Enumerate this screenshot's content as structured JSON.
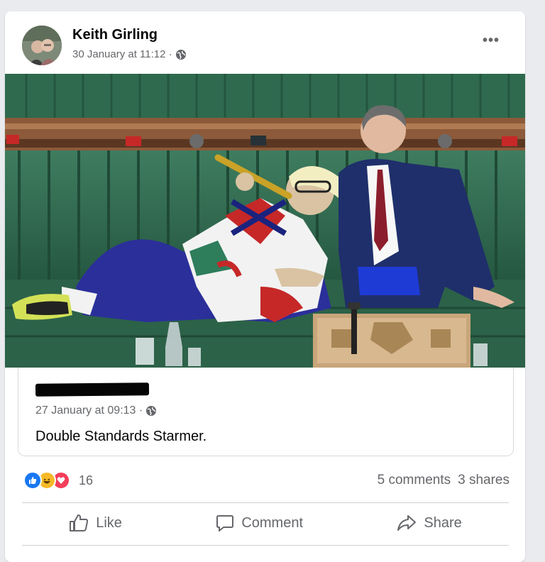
{
  "post": {
    "author": "Keith Girling",
    "timestamp": "30 January at 11:12 ·",
    "privacy_icon": "globe-icon",
    "more_label": "•••"
  },
  "shared": {
    "timestamp": "27 January at 09:13 ·",
    "privacy_icon": "globe-icon",
    "text": "Double Standards Starmer."
  },
  "reactions": {
    "icons": [
      "like-icon",
      "haha-icon",
      "love-icon"
    ],
    "count": "16"
  },
  "stats": {
    "comments": "5 comments",
    "shares": "3 shares"
  },
  "actions": {
    "like": "Like",
    "comment": "Comment",
    "share": "Share"
  },
  "colors": {
    "like_blue": "#1877f2",
    "haha_yellow": "#f7b928",
    "love_red": "#f33e58",
    "bench_green": "#2e6b4e"
  }
}
